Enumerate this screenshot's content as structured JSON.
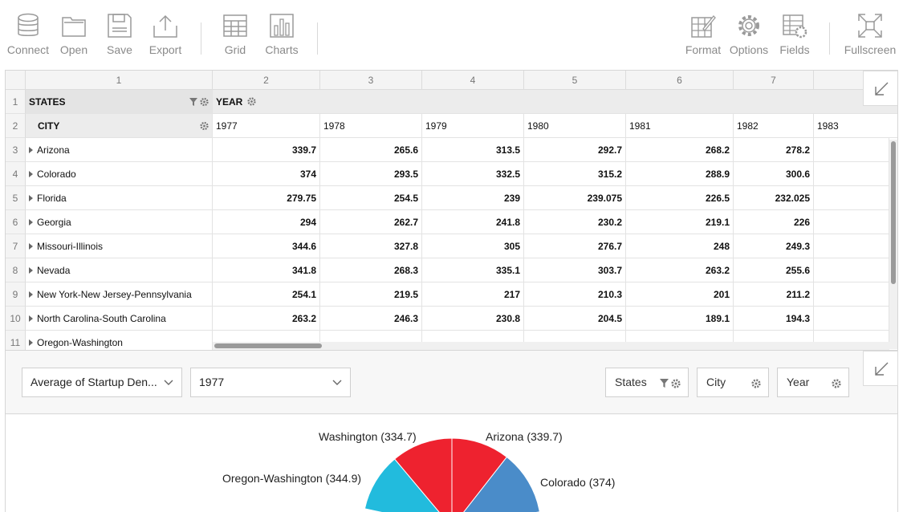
{
  "toolbar": {
    "left_buttons": [
      {
        "label": "Connect",
        "icon": "database-icon"
      },
      {
        "label": "Open",
        "icon": "folder-icon"
      },
      {
        "label": "Save",
        "icon": "save-icon"
      },
      {
        "label": "Export",
        "icon": "export-icon"
      }
    ],
    "view_buttons": [
      {
        "label": "Grid",
        "icon": "grid-icon"
      },
      {
        "label": "Charts",
        "icon": "charts-icon"
      }
    ],
    "right_buttons": [
      {
        "label": "Format",
        "icon": "format-icon"
      },
      {
        "label": "Options",
        "icon": "options-icon"
      },
      {
        "label": "Fields",
        "icon": "fields-icon"
      },
      {
        "label": "Fullscreen",
        "icon": "fullscreen-icon"
      }
    ]
  },
  "grid": {
    "column_numbers": [
      "1",
      "2",
      "3",
      "4",
      "5",
      "6",
      "7"
    ],
    "row_numbers": [
      "1",
      "2",
      "3",
      "4",
      "5",
      "6",
      "7",
      "8",
      "9",
      "10",
      "11"
    ],
    "row_header_title": "STATES",
    "column_header_title": "YEAR",
    "sub_row_header": "CITY",
    "years": [
      "1977",
      "1978",
      "1979",
      "1980",
      "1981",
      "1982",
      "1983"
    ],
    "rows": [
      {
        "label": "Arizona",
        "values": [
          "339.7",
          "265.6",
          "313.5",
          "292.7",
          "268.2",
          "278.2"
        ]
      },
      {
        "label": "Colorado",
        "values": [
          "374",
          "293.5",
          "332.5",
          "315.2",
          "288.9",
          "300.6"
        ]
      },
      {
        "label": "Florida",
        "values": [
          "279.75",
          "254.5",
          "239",
          "239.075",
          "226.5",
          "232.025"
        ]
      },
      {
        "label": "Georgia",
        "values": [
          "294",
          "262.7",
          "241.8",
          "230.2",
          "219.1",
          "226"
        ]
      },
      {
        "label": "Missouri-Illinois",
        "values": [
          "344.6",
          "327.8",
          "305",
          "276.7",
          "248",
          "249.3"
        ]
      },
      {
        "label": "Nevada",
        "values": [
          "341.8",
          "268.3",
          "335.1",
          "303.7",
          "263.2",
          "255.6"
        ]
      },
      {
        "label": "New York-New Jersey-Pennsylvania",
        "values": [
          "254.1",
          "219.5",
          "217",
          "210.3",
          "201",
          "211.2"
        ]
      },
      {
        "label": "North Carolina-South Carolina",
        "values": [
          "263.2",
          "246.3",
          "230.8",
          "204.5",
          "189.1",
          "194.3"
        ]
      },
      {
        "label": "Oregon-Washington",
        "values": [
          "",
          "",
          "",
          "",
          "",
          ""
        ]
      }
    ]
  },
  "chart_panel": {
    "measure_select": "Average of Startup Den...",
    "year_select": "1977",
    "filters": [
      {
        "label": "States",
        "has_filter_icon": true
      },
      {
        "label": "City",
        "has_filter_icon": false
      },
      {
        "label": "Year",
        "has_filter_icon": false
      }
    ]
  },
  "chart_data": {
    "type": "pie",
    "title": "",
    "slices": [
      {
        "label": "Arizona (339.7)",
        "category": "Arizona",
        "value": 339.7,
        "color": "#ee222f"
      },
      {
        "label": "Colorado (374)",
        "category": "Colorado",
        "value": 374,
        "color": "#4a8cc9"
      },
      {
        "label": "Oregon-Washington (344.9)",
        "category": "Oregon-Washington",
        "value": 344.9,
        "color": "#22bbdd"
      },
      {
        "label": "Washington (334.7)",
        "category": "Washington",
        "value": 334.7,
        "color": "#ee222f"
      }
    ]
  },
  "colors": {
    "toolbar_text": "#8a8a8a",
    "header_bg": "#e4e4e4",
    "pie_red": "#ee222f",
    "pie_blue": "#4a8cc9",
    "pie_cyan": "#22bbdd"
  }
}
